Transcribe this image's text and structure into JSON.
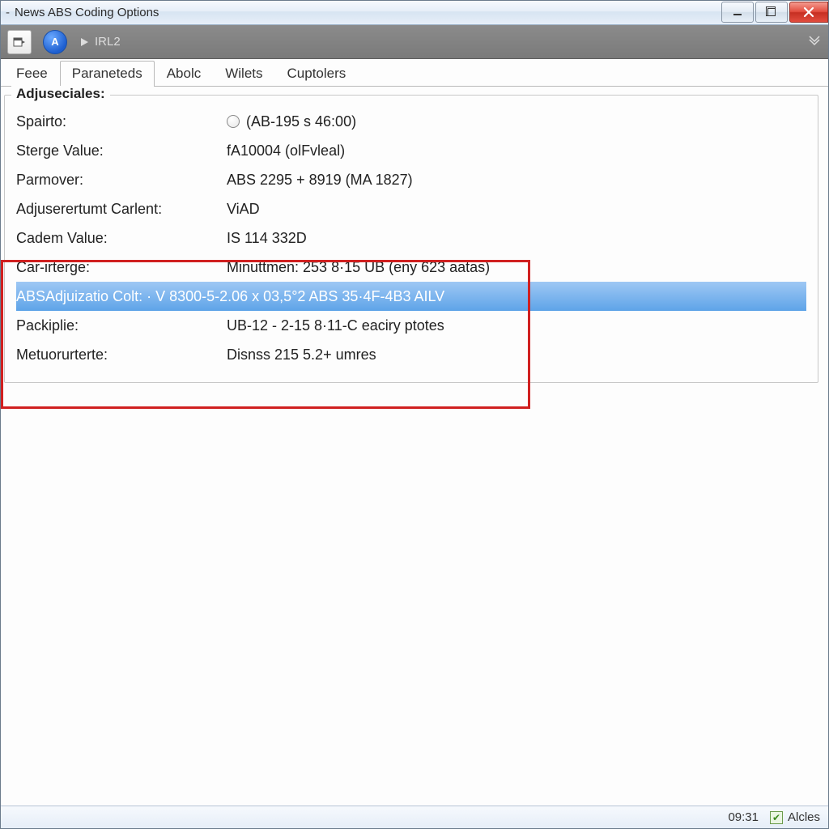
{
  "window": {
    "title": "News ABS Coding Options"
  },
  "toolbar": {
    "play_label": "IRL2"
  },
  "tabs": [
    {
      "label": "Feee"
    },
    {
      "label": "Paraneteds"
    },
    {
      "label": "Abolc"
    },
    {
      "label": "Wilets"
    },
    {
      "label": "Cuptolers"
    }
  ],
  "fieldset_title": "Adjuseciales:",
  "rows": [
    {
      "label": "Spairto:",
      "value": "(AB-195 s 46:00)",
      "has_radio": true
    },
    {
      "label": "Sterge Value:",
      "value": "fA10004 (olFvleal)"
    },
    {
      "label": "Parmover:",
      "value": "ABS 2295 + 8919 (MA 1827)"
    },
    {
      "label": "Adjuserertumt Carlent:",
      "value": "ViAD"
    },
    {
      "label": "Cadem Value:",
      "value": "IS 114 332D"
    },
    {
      "label": "Car-irterge:",
      "value": "Minuttmen: 253 8·15 UB (eny 623 aatas)"
    },
    {
      "label": "ABSAdjuizatio Colt: · V 8300-5-2.06 x 03,5°2 ABS 35·4F-4B3 AILV",
      "value": ""
    },
    {
      "label": "Packiplie:",
      "value": "UB-12 - 2-15 8·11-C eaciry ptotes"
    },
    {
      "label": "Metuorurterte:",
      "value": "Disnss 215 5.2+ umres"
    }
  ],
  "status": {
    "time": "09:31",
    "label": "Alcles"
  }
}
